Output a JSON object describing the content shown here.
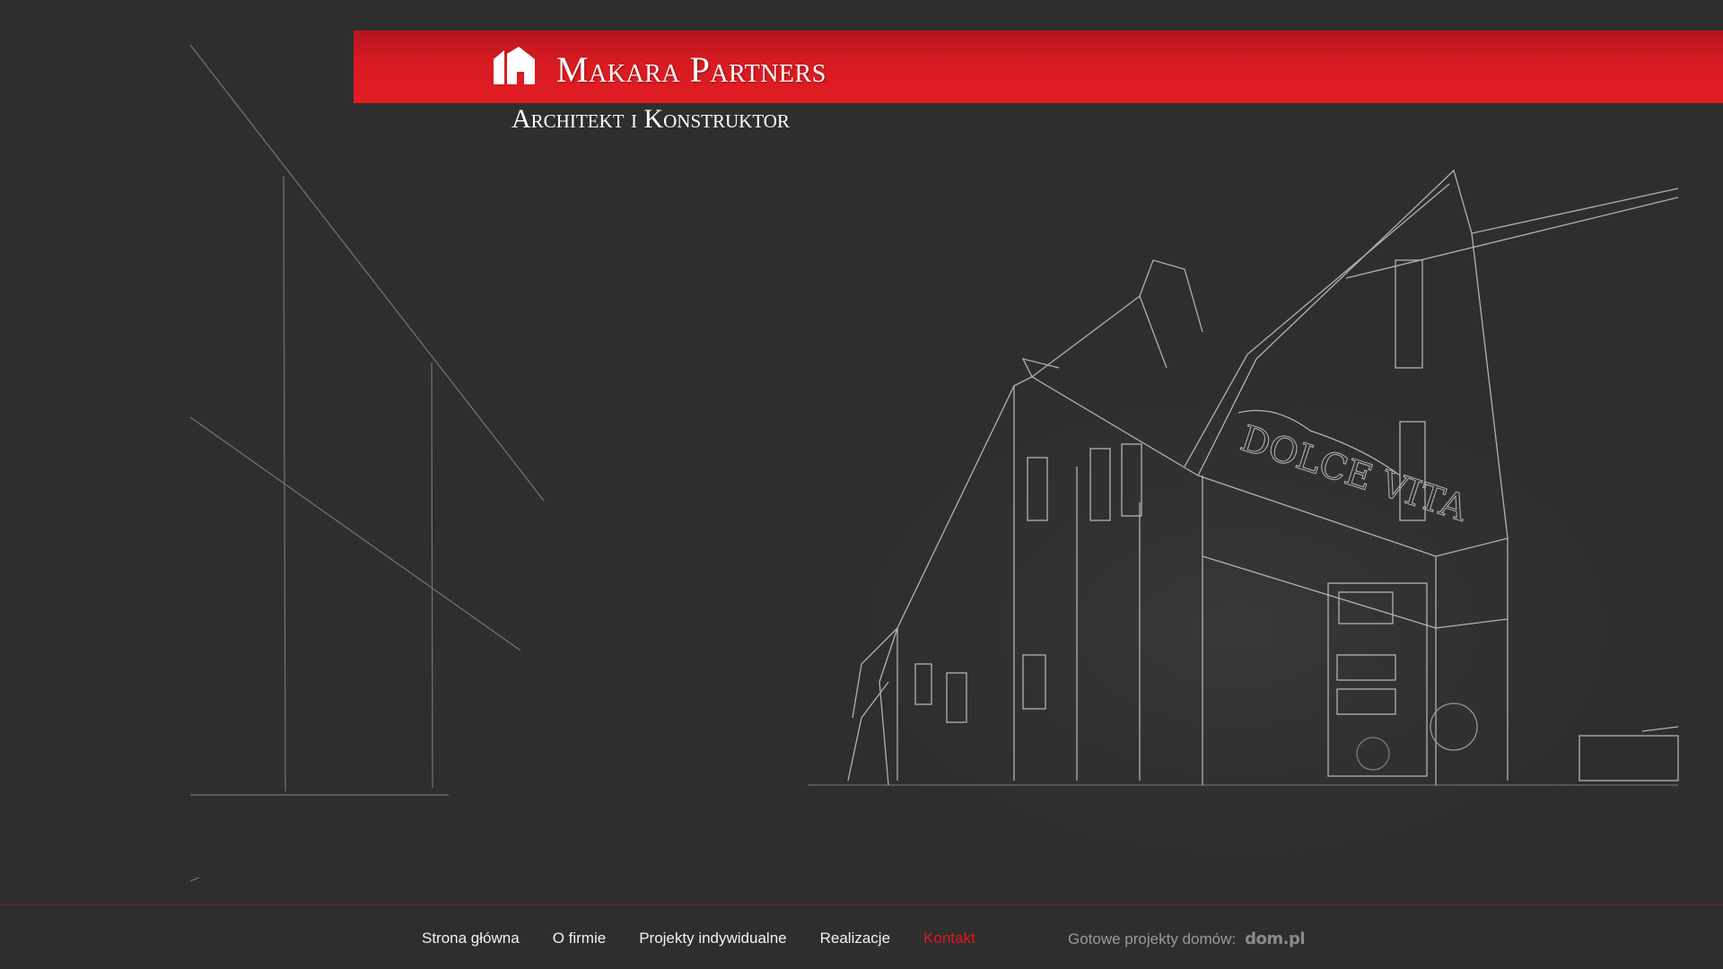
{
  "brand": {
    "name": "Makara Partners",
    "tagline": "Architekt i Konstruktor",
    "accent_color": "#e21d24",
    "logo_icon": "house-icon"
  },
  "nav": {
    "items": [
      {
        "label": "Strona główna"
      },
      {
        "label": "O firmie"
      },
      {
        "label": "Projekty indywidualne"
      },
      {
        "label": "Realizacje"
      },
      {
        "label": "Kontakt",
        "active": true
      }
    ],
    "active_color": "#e3161e"
  },
  "footer": {
    "ready_projects_label": "Gotowe projekty domów:",
    "partner_logo": "dom.pl"
  },
  "hero": {
    "sign_text": "DOLCE VITA"
  }
}
